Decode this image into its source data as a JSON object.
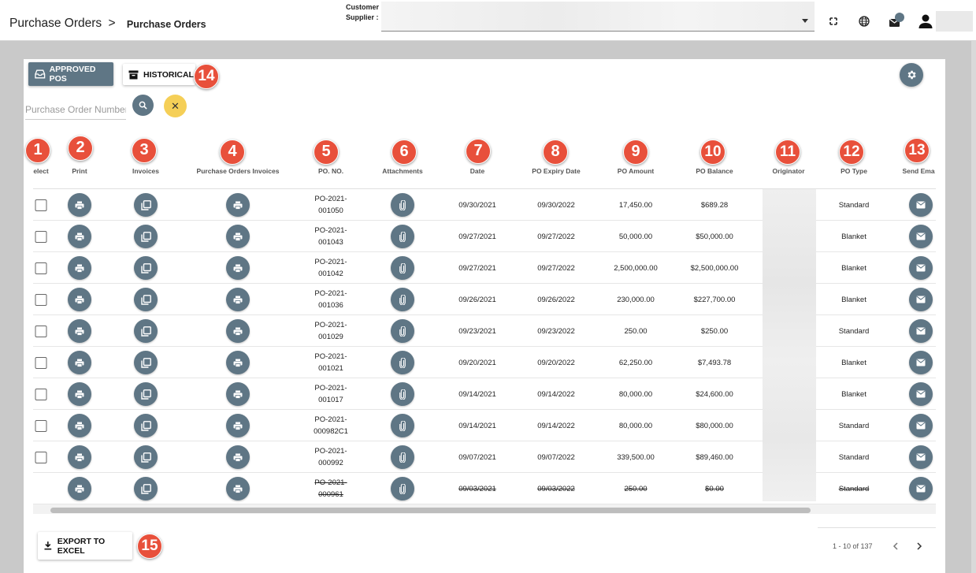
{
  "header": {
    "breadcrumb_parent": "Purchase Orders",
    "breadcrumb_sep": ">",
    "breadcrumb_current": "Purchase Orders",
    "supplier_label_1": "Customer",
    "supplier_label_2": "Supplier :",
    "icons": [
      "fullscreen-icon",
      "globe-icon",
      "messages-icon",
      "user-icon"
    ]
  },
  "toolbar": {
    "approved_label": "APPROVED POS",
    "historical_label": "HISTORICAL",
    "search_placeholder": "Purchase Order Number",
    "clear_glyph": "✕"
  },
  "markers": [
    "1",
    "2",
    "3",
    "4",
    "5",
    "6",
    "7",
    "8",
    "9",
    "10",
    "11",
    "12",
    "13",
    "14",
    "15"
  ],
  "columns": [
    "elect",
    "Print",
    "Invoices",
    "Purchase Orders Invoices",
    "PO. NO.",
    "Attachments",
    "Date",
    "PO Expiry Date",
    "PO Amount",
    "PO Balance",
    "Originator",
    "PO Type",
    "Send Ema"
  ],
  "rows": [
    {
      "po_no_1": "PO-2021-",
      "po_no_2": "001050",
      "date": "09/30/2021",
      "expiry": "09/30/2022",
      "amount": "17,450.00",
      "balance": "$689.28",
      "type": "Standard",
      "checkbox": true,
      "strike": false
    },
    {
      "po_no_1": "PO-2021-",
      "po_no_2": "001043",
      "date": "09/27/2021",
      "expiry": "09/27/2022",
      "amount": "50,000.00",
      "balance": "$50,000.00",
      "type": "Blanket",
      "checkbox": true,
      "strike": false
    },
    {
      "po_no_1": "PO-2021-",
      "po_no_2": "001042",
      "date": "09/27/2021",
      "expiry": "09/27/2022",
      "amount": "2,500,000.00",
      "balance": "$2,500,000.00",
      "type": "Blanket",
      "checkbox": true,
      "strike": false
    },
    {
      "po_no_1": "PO-2021-",
      "po_no_2": "001036",
      "date": "09/26/2021",
      "expiry": "09/26/2022",
      "amount": "230,000.00",
      "balance": "$227,700.00",
      "type": "Blanket",
      "checkbox": true,
      "strike": false
    },
    {
      "po_no_1": "PO-2021-",
      "po_no_2": "001029",
      "date": "09/23/2021",
      "expiry": "09/23/2022",
      "amount": "250.00",
      "balance": "$250.00",
      "type": "Standard",
      "checkbox": true,
      "strike": false
    },
    {
      "po_no_1": "PO-2021-",
      "po_no_2": "001021",
      "date": "09/20/2021",
      "expiry": "09/20/2022",
      "amount": "62,250.00",
      "balance": "$7,493.78",
      "type": "Blanket",
      "checkbox": true,
      "strike": false
    },
    {
      "po_no_1": "PO-2021-",
      "po_no_2": "001017",
      "date": "09/14/2021",
      "expiry": "09/14/2022",
      "amount": "80,000.00",
      "balance": "$24,600.00",
      "type": "Blanket",
      "checkbox": true,
      "strike": false
    },
    {
      "po_no_1": "PO-2021-",
      "po_no_2": "000982C1",
      "date": "09/14/2021",
      "expiry": "09/14/2022",
      "amount": "80,000.00",
      "balance": "$80,000.00",
      "type": "Standard",
      "checkbox": true,
      "strike": false
    },
    {
      "po_no_1": "PO-2021-",
      "po_no_2": "000992",
      "date": "09/07/2021",
      "expiry": "09/07/2022",
      "amount": "339,500.00",
      "balance": "$89,460.00",
      "type": "Standard",
      "checkbox": true,
      "strike": false
    },
    {
      "po_no_1": "PO-2021-",
      "po_no_2": "000961",
      "date": "09/03/2021",
      "expiry": "09/03/2022",
      "amount": "250.00",
      "balance": "$0.00",
      "type": "Standard",
      "checkbox": false,
      "strike": true
    }
  ],
  "footer": {
    "excel_label": "EXPORT TO EXCEL",
    "pager_text": "1 - 10 of 137"
  },
  "colors": {
    "accent": "#5f7685",
    "marker": "#e8503b",
    "clear": "#f5cf57"
  }
}
